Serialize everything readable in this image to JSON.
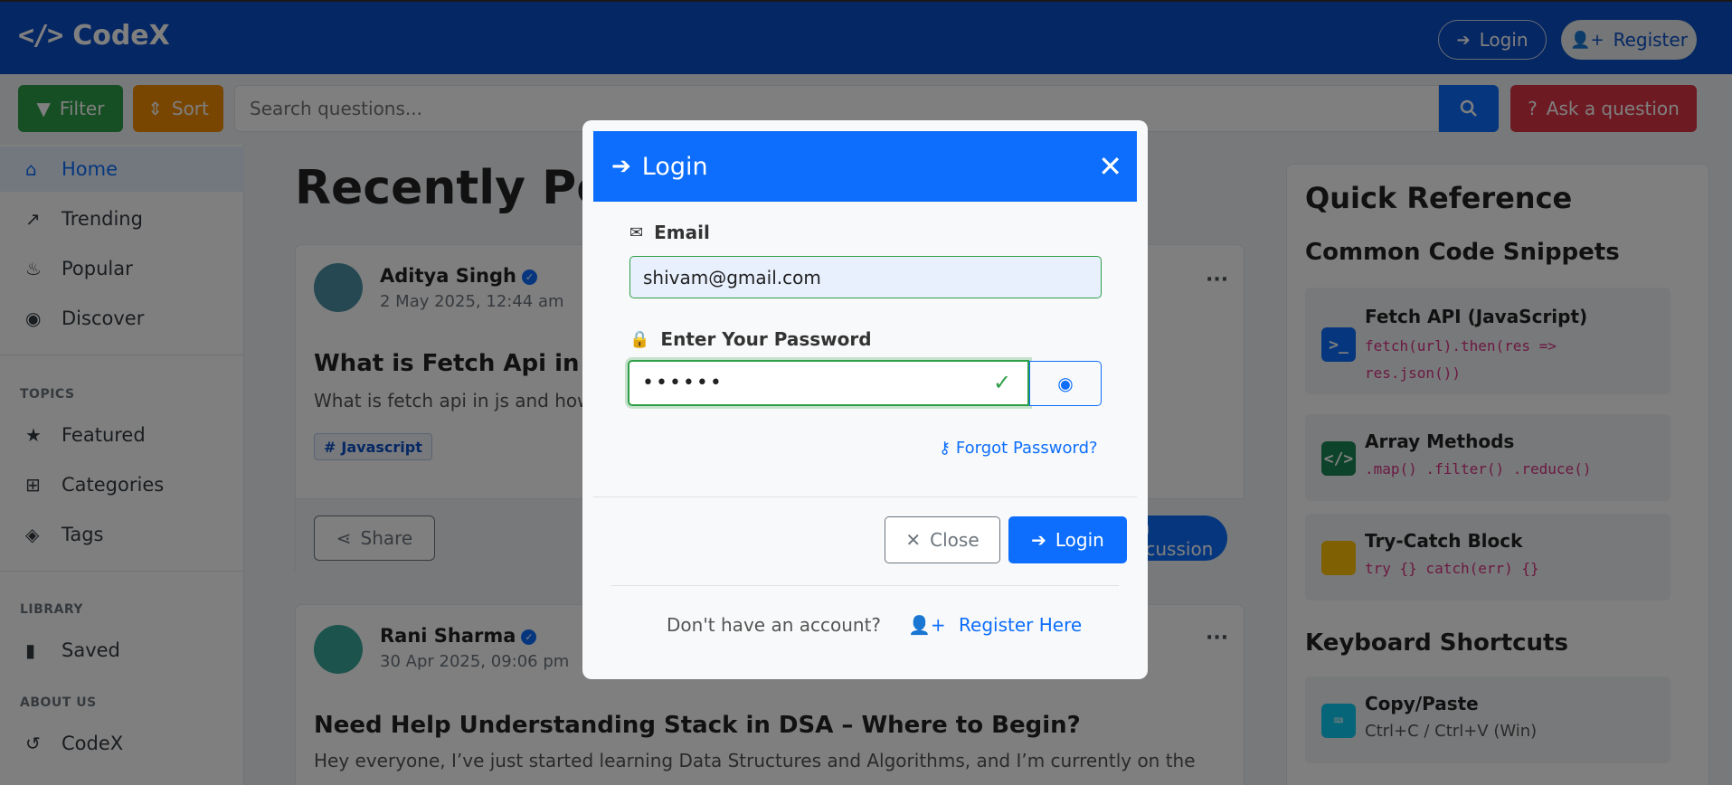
{
  "navbar": {
    "brand_icon": "</>",
    "brand": "CodeX",
    "login_label": "Login",
    "register_label": "Register"
  },
  "toolbar": {
    "filter_label": "Filter",
    "sort_label": "Sort",
    "search_placeholder": "Search questions...",
    "ask_label": "Ask a question"
  },
  "sidebar": {
    "main_items": [
      {
        "label": "Home",
        "icon": "home-icon",
        "active": true
      },
      {
        "label": "Trending",
        "icon": "trending-icon"
      },
      {
        "label": "Popular",
        "icon": "fire-icon"
      },
      {
        "label": "Discover",
        "icon": "compass-icon"
      }
    ],
    "topics_heading": "TOPICS",
    "topics": [
      {
        "label": "Featured",
        "icon": "star-icon"
      },
      {
        "label": "Categories",
        "icon": "grid-icon"
      },
      {
        "label": "Tags",
        "icon": "tags-icon"
      }
    ],
    "library_heading": "LIBRARY",
    "library": [
      {
        "label": "Saved",
        "icon": "bookmark-icon"
      }
    ],
    "about_heading": "ABOUT US",
    "about": [
      {
        "label": "CodeX",
        "icon": "history-icon"
      }
    ]
  },
  "main": {
    "title": "Recently Posted",
    "posts": [
      {
        "author": "Aditya Singh",
        "date": "2 May 2025, 12:44 am",
        "title": "What is Fetch Api in Javascript?",
        "excerpt": "What is fetch api in js and how does it work?",
        "tag": "Javascript",
        "share_label": "Share",
        "discuss_label": "Join Discussion"
      },
      {
        "author": "Rani Sharma",
        "date": "30 Apr 2025, 09:06 pm",
        "title": "Need Help Understanding Stack in DSA – Where to Begin?",
        "excerpt": "Hey everyone, I’ve just started learning Data Structures and Algorithms, and I’m currently on the"
      }
    ]
  },
  "quick_ref": {
    "title": "Quick Reference",
    "snippets_heading": "Common Code Snippets",
    "snippets": [
      {
        "title": "Fetch API (JavaScript)",
        "code_line1": "fetch(url).then(res =>",
        "code_line2": "res.json())",
        "color": "#0d6efd"
      },
      {
        "title": "Array Methods",
        "code_line1": ".map() .filter() .reduce()",
        "color": "#198754"
      },
      {
        "title": "Try-Catch Block",
        "code_line1": "try {} catch(err) {}",
        "color": "#ffc107"
      }
    ],
    "shortcuts_heading": "Keyboard Shortcuts",
    "shortcuts": [
      {
        "title": "Copy/Paste",
        "text": "Ctrl+C / Ctrl+V (Win)",
        "color": "#0dcaf0"
      }
    ]
  },
  "modal": {
    "title": "Login",
    "email_label": "Email",
    "email_value": "shivam@gmail.com",
    "password_label": "Enter Your Password",
    "password_value": "••••••",
    "forgot_label": "Forgot Password?",
    "close_label": "Close",
    "login_label": "Login",
    "no_account_text": "Don't have an account?",
    "register_label": "Register Here"
  }
}
